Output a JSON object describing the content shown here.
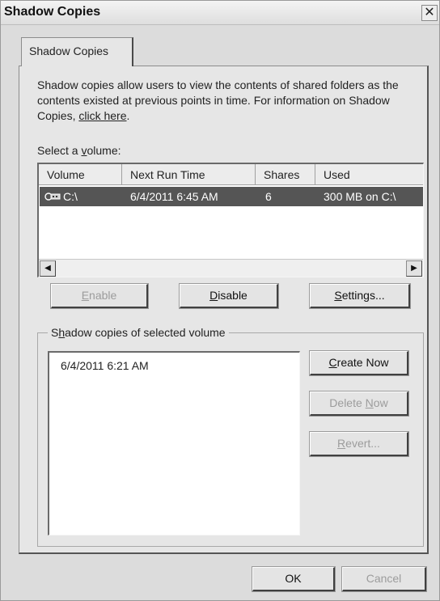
{
  "window": {
    "title": "Shadow Copies",
    "close_glyph": "✕"
  },
  "tabs": [
    {
      "label": "Shadow Copies",
      "active": true
    }
  ],
  "description": {
    "text": "Shadow copies allow users to view the contents of shared folders as the contents existed at previous points in time. For information on Shadow Copies, ",
    "link_text": "click here",
    "suffix": "."
  },
  "select_volume": {
    "label_prefix": "Select a ",
    "label_accel": "v",
    "label_rest": "olume:"
  },
  "volumes_table": {
    "columns": [
      "Volume",
      "Next Run Time",
      "Shares",
      "Used"
    ],
    "rows": [
      {
        "icon": "drive-icon",
        "volume": "C:\\",
        "next_run_time": "6/4/2011 6:45 AM",
        "shares": "6",
        "used": "300 MB on C:\\",
        "selected": true
      }
    ]
  },
  "volume_buttons": {
    "enable": {
      "accel": "E",
      "rest": "nable",
      "disabled": true
    },
    "disable": {
      "accel": "D",
      "rest": "isable",
      "disabled": false
    },
    "settings": {
      "accel": "S",
      "rest": "ettings...",
      "disabled": false
    }
  },
  "shadow_copies_group": {
    "label_prefix": "S",
    "label_accel": "h",
    "label_rest": "adow copies of selected volume",
    "items": [
      "6/4/2011 6:21 AM"
    ],
    "buttons": {
      "create_now": {
        "accel": "C",
        "rest": "reate Now",
        "disabled": false
      },
      "delete_now": {
        "prefix": "Delete ",
        "accel": "N",
        "rest": "ow",
        "disabled": true
      },
      "revert": {
        "accel": "R",
        "rest": "evert...",
        "disabled": true
      }
    }
  },
  "footer_buttons": {
    "ok": "OK",
    "cancel": "Cancel"
  },
  "colors": {
    "selection_bg": "#555555",
    "dialog_bg": "#e6e6e6",
    "disabled_text": "#9c9c9c"
  }
}
